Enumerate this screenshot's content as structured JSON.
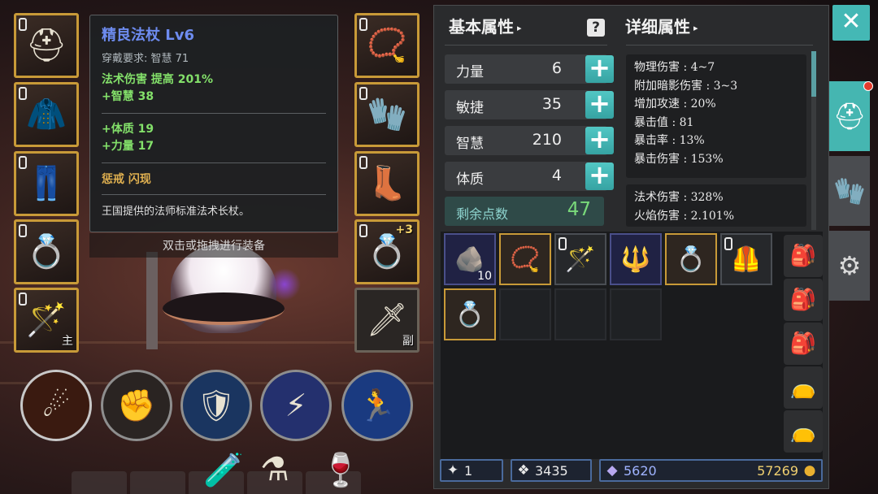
{
  "tooltip": {
    "name": "精良法杖  Lv6",
    "requirement": "穿戴要求:    智慧  71",
    "stats_main": [
      "法术伤害  提高  201%",
      "+智慧  38"
    ],
    "stats_bonus": [
      "+体质  19",
      "+力量  17"
    ],
    "skills": "惩戒    闪现",
    "description": "王国提供的法师标准法术长杖。"
  },
  "hint": "双击或拖拽进行装备",
  "equipment": {
    "left_slots": [
      {
        "icon": "helmet-icon",
        "glyph": "⛑",
        "badge": ""
      },
      {
        "icon": "chest-armor-icon",
        "glyph": "🧥",
        "badge": ""
      },
      {
        "icon": "pants-icon",
        "glyph": "👖",
        "badge": ""
      },
      {
        "icon": "ring-icon",
        "glyph": "💍",
        "badge": ""
      },
      {
        "icon": "staff-icon",
        "glyph": "🪄",
        "badge": "主"
      }
    ],
    "right_slots": [
      {
        "icon": "amulet-icon",
        "glyph": "📿",
        "badge": "",
        "plus": ""
      },
      {
        "icon": "gauntlet-icon",
        "glyph": "🧤",
        "badge": "",
        "plus": ""
      },
      {
        "icon": "boots-icon",
        "glyph": "👢",
        "badge": "",
        "plus": ""
      },
      {
        "icon": "ring-icon",
        "glyph": "💍",
        "badge": "",
        "plus": "+3"
      },
      {
        "icon": "sword-icon",
        "glyph": "🗡",
        "badge": "副",
        "plus": ""
      }
    ]
  },
  "skills": [
    {
      "icon": "meteor-icon",
      "glyph": "☄"
    },
    {
      "icon": "punish-icon",
      "glyph": "✊"
    },
    {
      "icon": "shield-dash-icon",
      "glyph": "🛡"
    },
    {
      "icon": "lightning-orb-icon",
      "glyph": "⚡"
    },
    {
      "icon": "dash-icon",
      "glyph": "🏃"
    }
  ],
  "potions": [
    {
      "icon": "potion-small-icon",
      "glyph": "🧪"
    },
    {
      "icon": "potion-medium-icon",
      "glyph": "⚗"
    },
    {
      "icon": "potion-large-icon",
      "glyph": "🍷"
    }
  ],
  "panel": {
    "basic_title": "基本属性",
    "detail_title": "详细属性",
    "attributes": [
      {
        "name": "力量",
        "value": "6"
      },
      {
        "name": "敏捷",
        "value": "35"
      },
      {
        "name": "智慧",
        "value": "210"
      },
      {
        "name": "体质",
        "value": "4"
      }
    ],
    "remaining_label": "剩余点数",
    "remaining_value": "47",
    "detail_group1": [
      "物理伤害 : 4~7",
      "附加暗影伤害 : 3~3",
      "增加攻速 : 20%",
      "暴击值 : 81",
      "暴击率 : 13%",
      "暴击伤害 : 153%"
    ],
    "detail_group2": [
      "法术伤害 : 328%",
      "火焰伤害 : 2.101%"
    ]
  },
  "inventory": {
    "row1": [
      {
        "icon": "ore-icon",
        "glyph": "🪨",
        "count": "10",
        "style": "blue"
      },
      {
        "icon": "amulet-icon",
        "glyph": "📿",
        "count": "",
        "style": "gold"
      },
      {
        "icon": "staff-icon",
        "glyph": "🪄",
        "count": "",
        "style": "dim"
      },
      {
        "icon": "mace-icon",
        "glyph": "🔱",
        "count": "",
        "style": "blue"
      },
      {
        "icon": "ring-icon",
        "glyph": "💍",
        "count": "",
        "style": "gold"
      },
      {
        "icon": "chest-armor-icon",
        "glyph": "🦺",
        "count": "",
        "style": "dim"
      }
    ],
    "row2": [
      {
        "icon": "ring-icon",
        "glyph": "💍",
        "count": "",
        "style": "gold"
      },
      {
        "icon": "",
        "glyph": "",
        "count": "",
        "style": "empty"
      },
      {
        "icon": "",
        "glyph": "",
        "count": "",
        "style": "empty"
      },
      {
        "icon": "",
        "glyph": "",
        "count": "",
        "style": "empty"
      }
    ],
    "side": [
      {
        "icon": "bag-gold-icon",
        "glyph": "🎒"
      },
      {
        "icon": "bag-gold-icon",
        "glyph": "🎒"
      },
      {
        "icon": "bag-gold-icon",
        "glyph": "🎒"
      },
      {
        "icon": "pouch-icon",
        "glyph": "👝"
      },
      {
        "icon": "pouch-icon",
        "glyph": "👝"
      }
    ]
  },
  "currency": {
    "wand_count": "1",
    "crystal_count": "3435",
    "gem_count": "5620",
    "gold_count": "57269"
  },
  "controls": {
    "close_glyph": "✕",
    "tabs": [
      {
        "icon": "helmet-tab-icon",
        "glyph": "⛑"
      },
      {
        "icon": "gloves-tab-icon",
        "glyph": "🧤"
      },
      {
        "icon": "settings-tab-icon",
        "glyph": "⚙"
      }
    ]
  },
  "colors": {
    "accent": "#45b6b1",
    "gold_border": "#c89a38",
    "item_name": "#6e8cf0",
    "bonus_green": "#83e06a"
  }
}
